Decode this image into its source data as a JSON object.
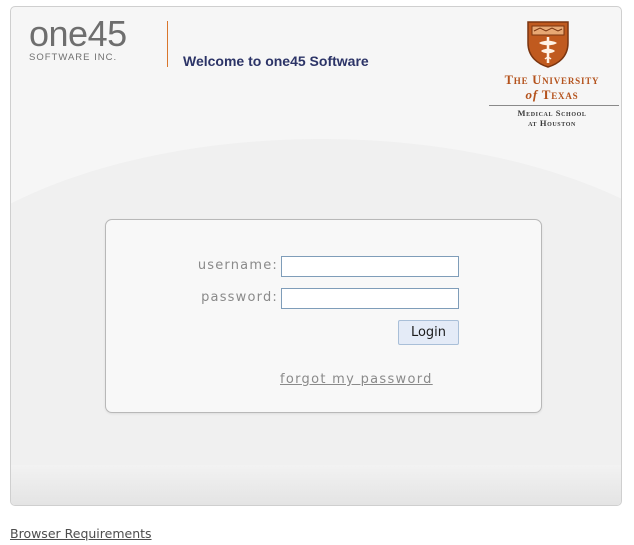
{
  "header": {
    "brand_name": "one45",
    "brand_sub": "SOFTWARE INC.",
    "welcome": "Welcome to one45 Software"
  },
  "institution": {
    "line1": "The University",
    "line2_of": "of",
    "line2_name": "Texas",
    "line3": "Medical School",
    "line4": "at Houston",
    "seal_icon": "ut-seal-icon",
    "accent_color": "#b4521c"
  },
  "login": {
    "username_label": "username:",
    "username_value": "",
    "password_label": "password:",
    "password_value": "",
    "login_button": "Login",
    "forgot_link": "forgot my password"
  },
  "footer": {
    "browser_requirements": "Browser Requirements"
  },
  "colors": {
    "welcome_text": "#2c3467",
    "brand_divider": "#d9762c",
    "input_border": "#7f9db9",
    "button_bg": "#e4ebf7"
  }
}
